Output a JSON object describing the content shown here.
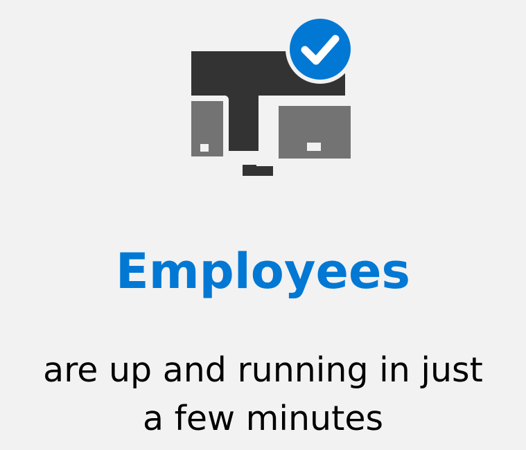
{
  "icon": "devices-with-checkmark-icon",
  "heading": "Employees",
  "subtitle": {
    "line1": "are up and running in just",
    "line2": "a few minutes"
  },
  "colors": {
    "background": "#f2f2f2",
    "accent": "#0078d4",
    "monitor_dark": "#333333",
    "device_gray": "#737373",
    "text": "#000000"
  }
}
